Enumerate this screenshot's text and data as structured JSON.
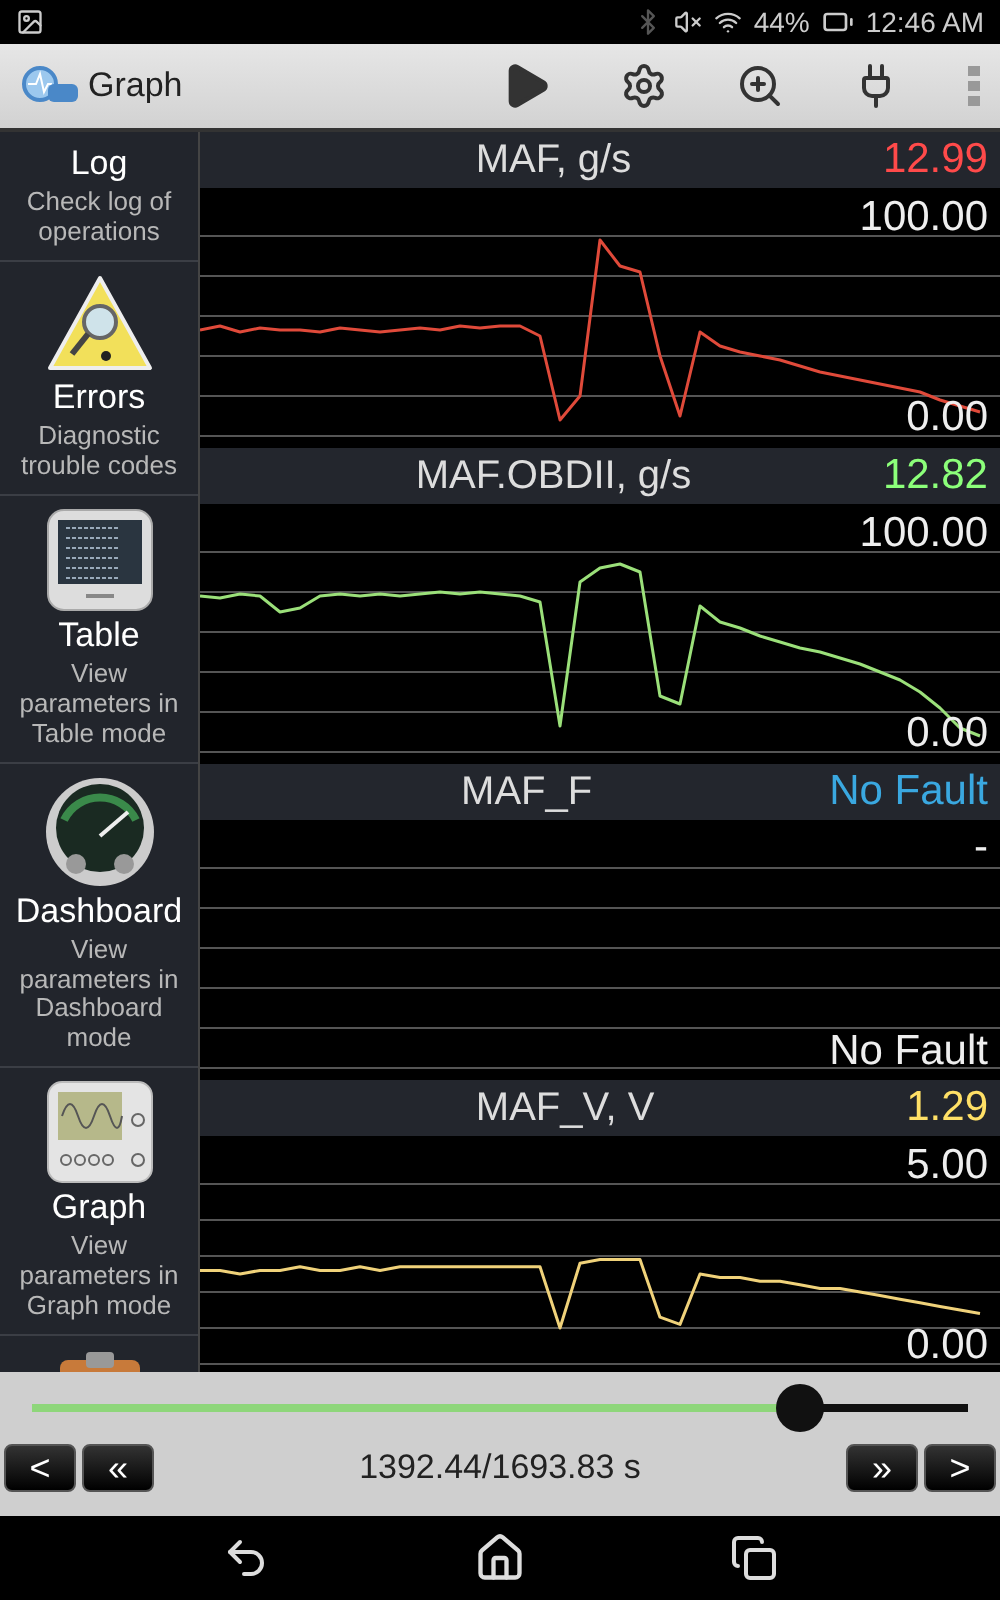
{
  "status_bar": {
    "battery": "44%",
    "time": "12:46 AM"
  },
  "app_bar": {
    "title": "Graph"
  },
  "sidebar": {
    "items": [
      {
        "kind": "log",
        "title": "Log",
        "subtitle": "Check log of operations"
      },
      {
        "kind": "errors",
        "title": "Errors",
        "subtitle": "Diagnostic trouble codes"
      },
      {
        "kind": "table",
        "title": "Table",
        "subtitle": "View parameters in Table mode"
      },
      {
        "kind": "dashboard",
        "title": "Dashboard",
        "subtitle": "View parameters in Dashboard mode"
      },
      {
        "kind": "graph",
        "title": "Graph",
        "subtitle": "View parameters in Graph mode"
      },
      {
        "kind": "report"
      }
    ]
  },
  "panels": [
    {
      "value": "12.99",
      "color": "#ff4a4a",
      "chart_data": {
        "type": "line",
        "ylim": [
          0,
          100
        ],
        "yticks": [
          {
            "value": 100,
            "label": "100.00"
          },
          {
            "value": 0,
            "label": "0.00"
          }
        ],
        "series": [
          {
            "name": "MAF, g/s",
            "color": "#e04a3a",
            "values": [
              53,
              55,
              52,
              54,
              53,
              53,
              52,
              54,
              53,
              52,
              53,
              54,
              53,
              55,
              54,
              55,
              55,
              50,
              8,
              20,
              98,
              85,
              82,
              40,
              10,
              52,
              45,
              42,
              40,
              38,
              35,
              32,
              30,
              28,
              26,
              24,
              22,
              18,
              15,
              12
            ]
          }
        ]
      }
    },
    {
      "value": "12.82",
      "color": "#8cff7a",
      "chart_data": {
        "type": "line",
        "ylim": [
          0,
          100
        ],
        "yticks": [
          {
            "value": 100,
            "label": "100.00"
          },
          {
            "value": 0,
            "label": "0.00"
          }
        ],
        "series": [
          {
            "name": "MAF.OBDII, g/s",
            "color": "#9be07a",
            "values": [
              78,
              77,
              79,
              78,
              70,
              72,
              78,
              79,
              78,
              79,
              78,
              79,
              80,
              79,
              80,
              79,
              78,
              75,
              13,
              85,
              92,
              94,
              90,
              28,
              24,
              73,
              65,
              62,
              58,
              55,
              52,
              50,
              47,
              44,
              40,
              36,
              30,
              22,
              12,
              8
            ]
          }
        ]
      }
    },
    {
      "name": "MAF_F",
      "value": "No Fault",
      "color": "#3aa8e0",
      "scale_top": "-",
      "scale_bottom": "No Fault"
    },
    {
      "value": "1.29",
      "color": "#ffe066",
      "chart_data": {
        "type": "line",
        "ylim": [
          0,
          5
        ],
        "yticks": [
          {
            "value": 5,
            "label": "5.00"
          },
          {
            "value": 0,
            "label": "0.00"
          }
        ],
        "series": [
          {
            "name": "MAF_V, V",
            "color": "#f0d27a",
            "values": [
              2.6,
              2.6,
              2.5,
              2.6,
              2.6,
              2.7,
              2.6,
              2.6,
              2.7,
              2.6,
              2.7,
              2.7,
              2.7,
              2.7,
              2.7,
              2.7,
              2.7,
              2.7,
              1.0,
              2.8,
              2.9,
              2.9,
              2.9,
              1.3,
              1.1,
              2.5,
              2.4,
              2.4,
              2.3,
              2.3,
              2.2,
              2.1,
              2.1,
              2.0,
              1.9,
              1.8,
              1.7,
              1.6,
              1.5,
              1.4
            ]
          }
        ]
      }
    }
  ],
  "playback": {
    "level": 0.82,
    "position": "1392.44/1693.83 s",
    "buttons": [
      "<",
      "«",
      "»",
      ">"
    ]
  }
}
